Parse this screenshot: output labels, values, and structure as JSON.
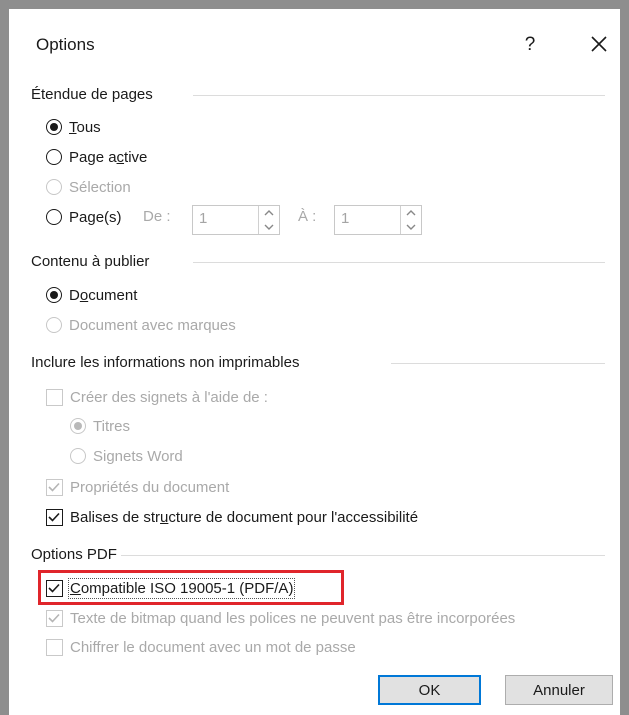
{
  "dialog": {
    "title": "Options",
    "help": "?"
  },
  "page_range": {
    "header": "Étendue de pages",
    "all": {
      "pre": "",
      "key": "T",
      "post": "ous",
      "selected": true
    },
    "active": {
      "pre": "Page a",
      "key": "c",
      "post": "tive",
      "selected": false
    },
    "selection": {
      "label": "Sélection",
      "disabled": true
    },
    "pages": {
      "pre": "Pa",
      "key": "g",
      "post": "e(s)",
      "selected": false
    },
    "from_label": "De :",
    "from_value": "1",
    "to_label": "À :",
    "to_value": "1"
  },
  "content": {
    "header": "Contenu à publier",
    "document": {
      "pre": "D",
      "key": "o",
      "post": "cument",
      "selected": true
    },
    "document_markup": {
      "label": "Document avec marques",
      "disabled": true
    }
  },
  "nonprint": {
    "header": "Inclure les informations non imprimables",
    "bookmarks": {
      "label": "Créer des signets à l'aide de :",
      "checked": false,
      "disabled": true
    },
    "titles": {
      "label": "Titres",
      "selected": true,
      "disabled": true
    },
    "word_bookmarks": {
      "label": "Signets Word",
      "selected": false,
      "disabled": true
    },
    "doc_props": {
      "label": "Propriétés du document",
      "checked": true,
      "disabled": true
    },
    "struct_tags": {
      "pre": "Balises de str",
      "key": "u",
      "post": "cture de document pour l'accessibilité",
      "checked": true
    }
  },
  "pdf_options": {
    "header": "Options PDF",
    "iso": {
      "pre": "",
      "key": "C",
      "post": "ompatible ISO 19005-1 (PDF/A)",
      "checked": true
    },
    "bitmap": {
      "label": "Texte de bitmap quand les polices ne peuvent pas être incorporées",
      "checked": true,
      "disabled": true
    },
    "encrypt": {
      "label": "Chiffrer le document avec un mot de passe",
      "checked": false,
      "disabled": true
    }
  },
  "buttons": {
    "ok": "OK",
    "cancel": "Annuler"
  },
  "colors": {
    "highlight": "#e0252b",
    "primary_border": "#0078d7",
    "window_border": "#8e8e8e"
  }
}
